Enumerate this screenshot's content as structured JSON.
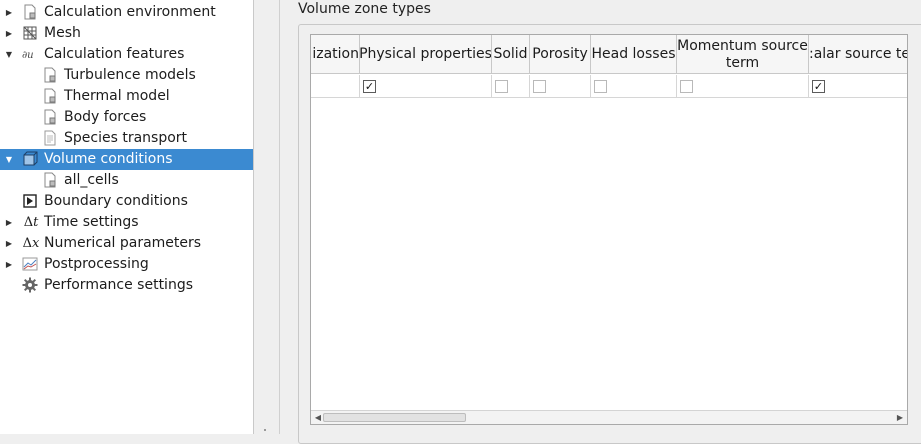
{
  "tree": {
    "items": [
      {
        "label": "Calculation environment",
        "icon": "page-icon",
        "expander": "collapsed"
      },
      {
        "label": "Mesh",
        "icon": "mesh-icon",
        "expander": "collapsed"
      },
      {
        "label": "Calculation features",
        "icon": "formula-icon",
        "expander": "expanded"
      },
      {
        "label": "Turbulence models",
        "icon": "page-icon",
        "expander": "none"
      },
      {
        "label": "Thermal model",
        "icon": "page-icon",
        "expander": "none"
      },
      {
        "label": "Body forces",
        "icon": "page-icon",
        "expander": "none"
      },
      {
        "label": "Species transport",
        "icon": "document-icon",
        "expander": "none"
      },
      {
        "label": "Volume conditions",
        "icon": "cube-icon",
        "expander": "expanded",
        "selected": true
      },
      {
        "label": "all_cells",
        "icon": "page-icon",
        "expander": "none"
      },
      {
        "label": "Boundary conditions",
        "icon": "boundary-icon",
        "expander": "none"
      },
      {
        "label": "Time settings",
        "icon": "delta-t-icon",
        "expander": "collapsed"
      },
      {
        "label": "Numerical parameters",
        "icon": "delta-x-icon",
        "expander": "collapsed"
      },
      {
        "label": "Postprocessing",
        "icon": "chart-icon",
        "expander": "collapsed"
      },
      {
        "label": "Performance settings",
        "icon": "gear-icon",
        "expander": "none"
      }
    ],
    "glyphs": {
      "delta_t": "Δ𝑡",
      "delta_x": "Δ𝑥"
    }
  },
  "panel": {
    "group_title": "Volume zone types",
    "columns": [
      "ization",
      "Physical properties",
      "Solid",
      "Porosity",
      "Head losses",
      "Momentum source term",
      ":alar source ter"
    ],
    "row": [
      null,
      true,
      false,
      false,
      false,
      false,
      true
    ],
    "check_glyph": "✓",
    "scroll_left_glyph": "◀",
    "scroll_right_glyph": "▶"
  },
  "colors": {
    "selection": "#3b8ad1",
    "background": "#efefef"
  }
}
